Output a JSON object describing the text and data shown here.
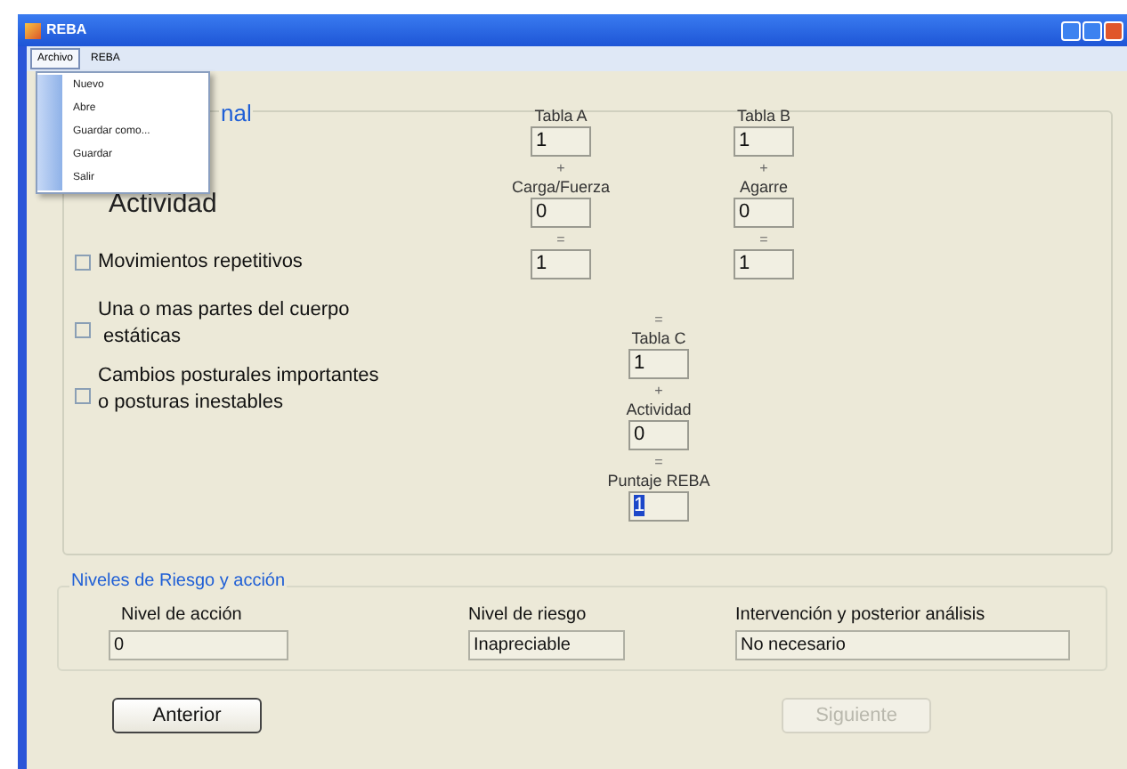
{
  "window": {
    "title": "REBA"
  },
  "menu": [
    {
      "label": "Archivo",
      "selected": true
    },
    {
      "label": "REBA",
      "selected": false
    }
  ],
  "dropdown": [
    "Nuevo",
    "Abre",
    "Guardar como...",
    "Guardar",
    "Salir"
  ],
  "group_title": "nal",
  "section_title": "Actividad",
  "checkboxes": [
    {
      "lines": [
        "Movimientos repetitivos"
      ],
      "checked": false
    },
    {
      "lines": [
        "Una o mas partes del cuerpo",
        " estáticas"
      ],
      "checked": false
    },
    {
      "lines": [
        "Cambios posturales importantes",
        "o posturas inestables"
      ],
      "checked": false
    }
  ],
  "columns": [
    [
      {
        "kind": "label",
        "text": "Tabla A"
      },
      {
        "kind": "field",
        "value": "1",
        "highlighted": false
      },
      {
        "kind": "op",
        "text": "+"
      },
      {
        "kind": "label",
        "text": "Carga/Fuerza"
      },
      {
        "kind": "field",
        "value": "0",
        "highlighted": false
      },
      {
        "kind": "op",
        "text": "="
      },
      {
        "kind": "field",
        "value": "1",
        "highlighted": false
      }
    ],
    [
      {
        "kind": "label",
        "text": "Tabla B"
      },
      {
        "kind": "field",
        "value": "1",
        "highlighted": false
      },
      {
        "kind": "op",
        "text": "+"
      },
      {
        "kind": "label",
        "text": "Agarre"
      },
      {
        "kind": "field",
        "value": "0",
        "highlighted": false
      },
      {
        "kind": "op",
        "text": "="
      },
      {
        "kind": "field",
        "value": "1",
        "highlighted": false
      }
    ],
    [
      {
        "kind": "op",
        "text": "="
      },
      {
        "kind": "label",
        "text": "Tabla C"
      },
      {
        "kind": "field",
        "value": "1",
        "highlighted": false
      },
      {
        "kind": "op",
        "text": "+"
      },
      {
        "kind": "label",
        "text": "Actividad"
      },
      {
        "kind": "field",
        "value": "0",
        "highlighted": false
      },
      {
        "kind": "op",
        "text": "="
      },
      {
        "kind": "label",
        "text": "Puntaje REBA"
      },
      {
        "kind": "field",
        "value": "1",
        "highlighted": true
      }
    ]
  ],
  "risk": {
    "title": "Niveles de Riesgo y acción",
    "fields": [
      {
        "label": "Nivel de acción",
        "value": "0"
      },
      {
        "label": "Nivel de riesgo",
        "value": "Inapreciable"
      },
      {
        "label": "Intervención y posterior análisis",
        "value": "No necesario"
      }
    ]
  },
  "buttons": [
    {
      "label": "Anterior",
      "disabled": false
    },
    {
      "label": "Siguiente",
      "disabled": true
    }
  ]
}
